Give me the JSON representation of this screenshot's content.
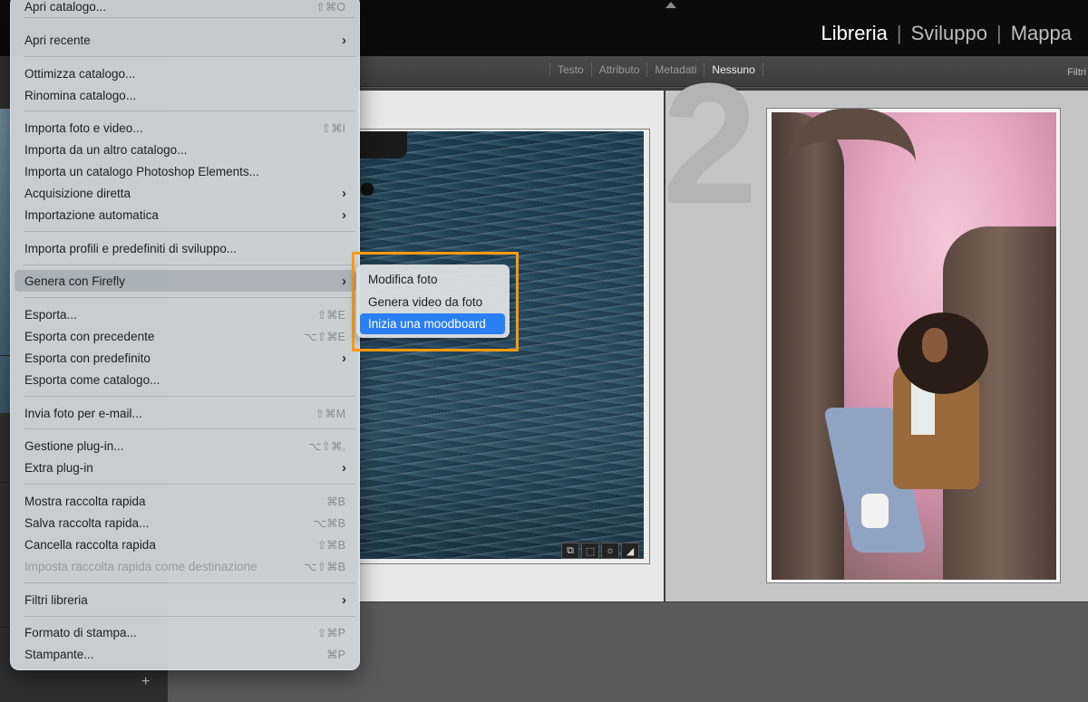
{
  "header": {
    "modules": [
      {
        "label": "Libreria",
        "active": true
      },
      {
        "label": "Sviluppo",
        "active": false
      },
      {
        "label": "Mappa",
        "active": false
      }
    ]
  },
  "filterbar": {
    "filters": [
      {
        "label": "Testo",
        "active": false
      },
      {
        "label": "Attributo",
        "active": false
      },
      {
        "label": "Metadati",
        "active": false
      },
      {
        "label": "Nessuno",
        "active": true
      }
    ],
    "right_label": "Filtri"
  },
  "grid": {
    "cell_number": "2"
  },
  "menu": {
    "items": [
      {
        "label": "Apri catalogo...",
        "shortcut": "⇧⌘O"
      },
      {
        "label": "Apri recente",
        "submenu": true
      },
      {
        "label": "Ottimizza catalogo..."
      },
      {
        "label": "Rinomina catalogo..."
      },
      {
        "label": "Importa foto e video...",
        "shortcut": "⇧⌘I"
      },
      {
        "label": "Importa da un altro catalogo..."
      },
      {
        "label": "Importa un catalogo Photoshop Elements..."
      },
      {
        "label": "Acquisizione diretta",
        "submenu": true
      },
      {
        "label": "Importazione automatica",
        "submenu": true
      },
      {
        "label": "Importa profili e predefiniti di sviluppo..."
      },
      {
        "label": "Genera con Firefly",
        "submenu": true,
        "hover": true
      },
      {
        "label": "Esporta...",
        "shortcut": "⇧⌘E"
      },
      {
        "label": "Esporta con precedente",
        "shortcut": "⌥⇧⌘E"
      },
      {
        "label": "Esporta con predefinito",
        "submenu": true
      },
      {
        "label": "Esporta come catalogo..."
      },
      {
        "label": "Invia foto per e-mail...",
        "shortcut": "⇧⌘M"
      },
      {
        "label": "Gestione plug-in...",
        "shortcut": "⌥⇧⌘,"
      },
      {
        "label": "Extra plug-in",
        "submenu": true
      },
      {
        "label": "Mostra raccolta rapida",
        "shortcut": "⌘B"
      },
      {
        "label": "Salva raccolta rapida...",
        "shortcut": "⌥⌘B"
      },
      {
        "label": "Cancella raccolta rapida",
        "shortcut": "⇧⌘B"
      },
      {
        "label": "Imposta raccolta rapida come destinazione",
        "shortcut": "⌥⇧⌘B",
        "disabled": true
      },
      {
        "label": "Filtri libreria",
        "submenu": true
      },
      {
        "label": "Formato di stampa...",
        "shortcut": "⇧⌘P"
      },
      {
        "label": "Stampante...",
        "shortcut": "⌘P"
      }
    ]
  },
  "submenu": {
    "items": [
      {
        "label": "Modifica foto"
      },
      {
        "label": "Genera video da foto"
      },
      {
        "label": "Inizia una moodboard",
        "selected": true
      }
    ]
  },
  "colors": {
    "highlight_box": "#ff9b0f",
    "selection": "#2a7ff3"
  }
}
